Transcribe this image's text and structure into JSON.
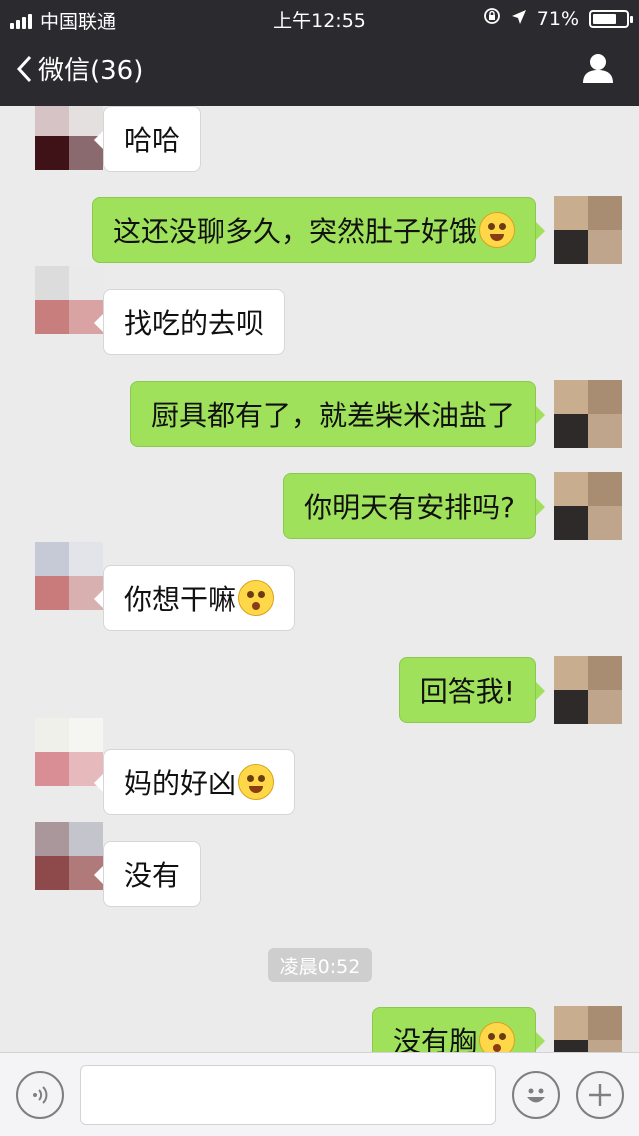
{
  "status_bar": {
    "carrier": "中国联通",
    "time": "上午12:55",
    "battery": "71%",
    "battery_level": 0.71
  },
  "nav": {
    "back_label": "微信(36)",
    "profile_icon": "person-icon"
  },
  "messages": [
    {
      "side": "in",
      "text": "哈哈"
    },
    {
      "side": "out",
      "text": "这还没聊多久，突然肚子好饿",
      "emoji": "crying-laughing"
    },
    {
      "side": "in",
      "text": "找吃的去呗"
    },
    {
      "side": "out",
      "text": "厨具都有了，就差柴米油盐了"
    },
    {
      "side": "out",
      "text": "你明天有安排吗?"
    },
    {
      "side": "in",
      "text": "你想干嘛",
      "emoji": "flushed"
    },
    {
      "side": "out",
      "text": "回答我!"
    },
    {
      "side": "in",
      "text": "妈的好凶",
      "emoji": "crying-laughing"
    },
    {
      "side": "in",
      "text": "没有"
    },
    {
      "side": "out",
      "text": "没有胸",
      "emoji": "flushed"
    }
  ],
  "timestamp": "凌晨0:52",
  "input_bar": {
    "voice_icon": "voice-icon",
    "emoji_icon": "emoji-icon",
    "plus_icon": "plus-icon",
    "text_value": ""
  }
}
